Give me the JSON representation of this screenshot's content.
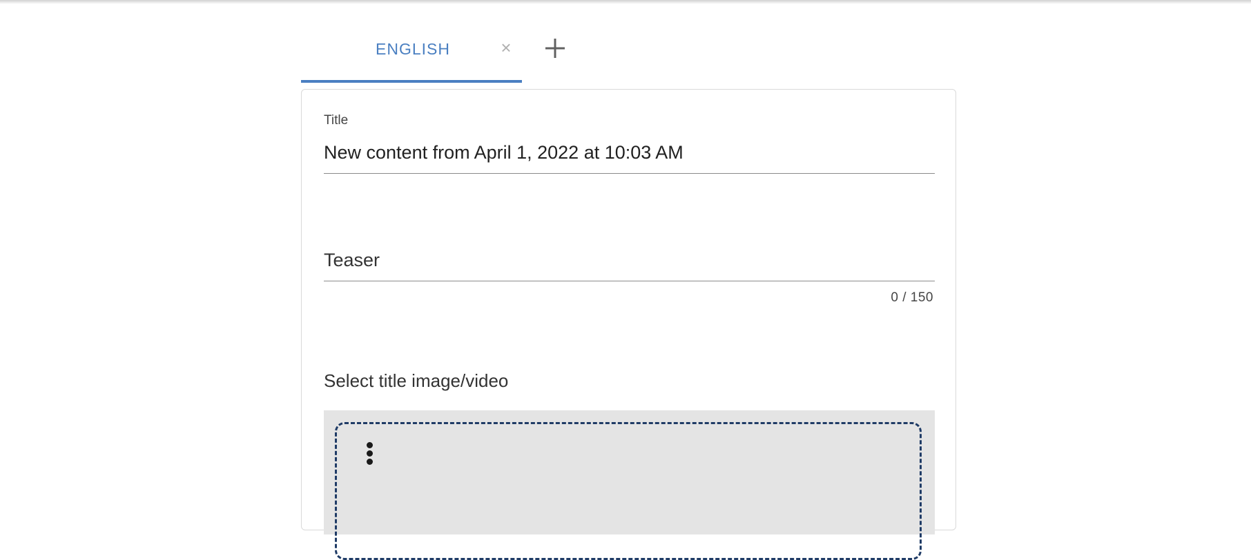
{
  "tabs": [
    {
      "label": "ENGLISH",
      "active": true
    }
  ],
  "icons": {
    "close": "close-icon",
    "add": "plus-icon",
    "menu": "more-vert-icon"
  },
  "colors": {
    "accent": "#4a7fc1",
    "dropzone_border": "#1f3b66",
    "media_background": "#e4e4e4"
  },
  "form": {
    "title_label": "Title",
    "title_value": "New content from April 1, 2022 at 10:03 AM",
    "teaser_placeholder": "Teaser",
    "teaser_value": "",
    "teaser_counter": "0 / 150",
    "media_section_title": "Select title image/video"
  }
}
